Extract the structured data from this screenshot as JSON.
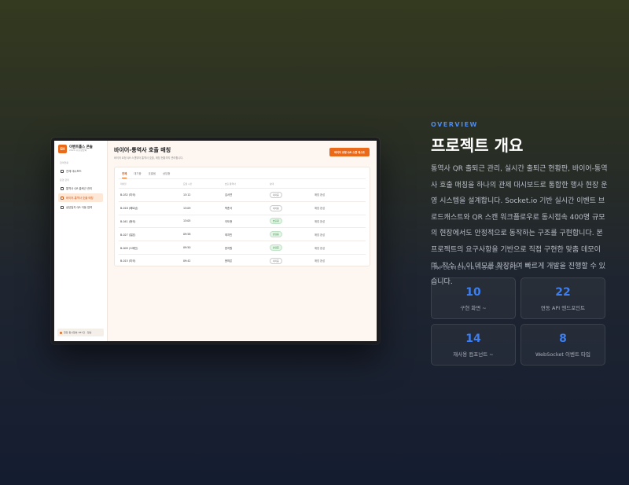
{
  "mockup": {
    "brand": {
      "logo": "EH",
      "name": "이벤트홀스 콘솔",
      "sub": "2024 수출상담회"
    },
    "nav_sections": [
      "참여현황",
      "운영 관리"
    ],
    "nav_items": [
      {
        "label": "전체 대시보드",
        "icon": "grid-icon"
      },
      {
        "label": "통역사 QR 출퇴근 관리",
        "icon": "qr-icon"
      },
      {
        "label": "바이어-통역사 호출 매칭",
        "icon": "phone-icon"
      },
      {
        "label": "상담일지 QR 이동 업력",
        "icon": "document-icon"
      }
    ],
    "footer_status": "현장 동시접속 387건 · 정상",
    "title": "바이어-통역사 호출 매칭",
    "subtitle": "바이어 요청 QR 스캔부터 통역사 호출, 매칭 현황까지 관리합니다.",
    "cta_label": "바이어 요청 QR 스캔 테스트",
    "tabs": [
      "전체",
      "대기중",
      "호출됨",
      "상담중"
    ],
    "columns": [
      "테이블",
      "요청 시간",
      "호출 통역사",
      "상태",
      ""
    ],
    "rows": [
      {
        "table": "B-032 (미국)",
        "time": "13:12",
        "interpreter": "김서연",
        "status": "대기중",
        "action": "매칭 완성"
      },
      {
        "table": "B-018 (베트남)",
        "time": "13:09",
        "interpreter": "박준서",
        "status": "대기중",
        "action": "매칭 완성"
      },
      {
        "table": "B-041 (중국)",
        "time": "13:05",
        "interpreter": "이도현",
        "status": "호출됨",
        "action": "매칭 완성"
      },
      {
        "table": "B-027 (일본)",
        "time": "09:58",
        "interpreter": "최지민",
        "status": "상담중",
        "action": "매칭 완성"
      },
      {
        "table": "B-009 (스페인)",
        "time": "09:50",
        "interpreter": "한지원",
        "status": "상담중",
        "action": "매칭 완성"
      },
      {
        "table": "B-015 (미국)",
        "time": "09:42",
        "interpreter": "윤하은",
        "status": "대기중",
        "action": "매칭 완성"
      }
    ],
    "colors": {
      "accent": "#ea6a1a",
      "success": "#2e8a3e"
    }
  },
  "overview": {
    "eyebrow": "OVERVIEW",
    "title": "프로젝트 개요",
    "description": "통역사 QR 출퇴근 관리, 실시간 출퇴근 현황판, 바이어-통역사 호출 매칭을 하나의 관제 대시보드로 통합한 행사 현장 운영 시스템을 설계합니다. Socket.io 기반 실시간 이벤트 브로드캐스트와 QR 스캔 워크플로우로 동시접속 400명 규모의 현장에서도 안정적으로 동작하는 구조를 구현합니다. 본 프로젝트의 요구사항을 기반으로 직접 구현한 맞춤 데모이며, 착수 시 이 데모를 확장하여 빠르게 개발을 진행할 수 있습니다.",
    "scope_label": "IMPLEMENTATION SCOPE",
    "stats": [
      {
        "value": "10",
        "label": "구현 화면 ~"
      },
      {
        "value": "22",
        "label": "연동 API 엔드포인트"
      },
      {
        "value": "14",
        "label": "재사용 컴포넌트 ~"
      },
      {
        "value": "8",
        "label": "WebSocket 이벤트 타입"
      }
    ],
    "colors": {
      "eyebrow": "#4f8ae8",
      "stat_value": "#3d7ff0"
    }
  }
}
